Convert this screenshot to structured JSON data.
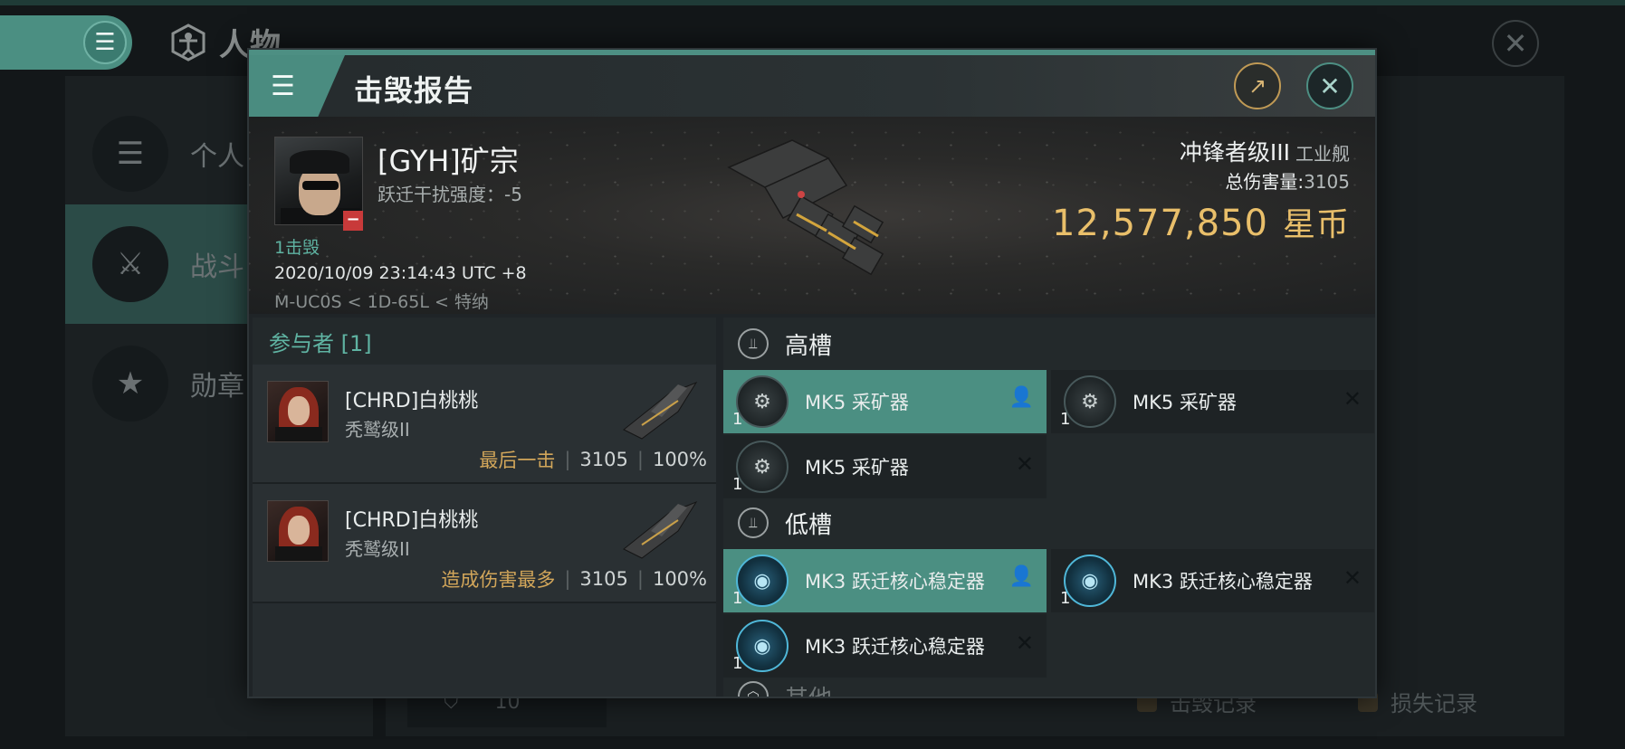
{
  "background": {
    "title": "人物",
    "side_items": [
      {
        "label": "个人",
        "icon": "list-icon"
      },
      {
        "label": "战斗",
        "icon": "crossed-swords-icon"
      },
      {
        "label": "勋章",
        "icon": "star-badge-icon"
      }
    ],
    "bottom_value": "10",
    "bottom_links": [
      "击毁记录",
      "损失记录"
    ]
  },
  "modal": {
    "title": "击毁报告",
    "victim": {
      "name": "[GYH]矿宗",
      "warp_disrupt": "跃迁干扰强度：-5",
      "kill_count": "1击毁",
      "time": "2020/10/09 23:14:43 UTC +8",
      "location": "M-UC0S < 1D-65L < 特纳"
    },
    "ship": {
      "name": "冲锋者级III",
      "class": "工业舰",
      "damage_label": "总伤害量:",
      "damage_value": "3105",
      "isk_value": "12,577,850",
      "isk_unit": "星币"
    },
    "participants": {
      "header": "参与者 [1]",
      "rows": [
        {
          "name": "[CHRD]白桃桃",
          "ship": "秃鹫级II",
          "tag": "最后一击",
          "damage": "3105",
          "percent": "100%"
        },
        {
          "name": "[CHRD]白桃桃",
          "ship": "秃鹫级II",
          "tag": "造成伤害最多",
          "damage": "3105",
          "percent": "100%"
        }
      ]
    },
    "slots": {
      "high_label": "高槽",
      "high": [
        {
          "name": "MK5 采矿器",
          "qty": "1",
          "state": "fitted"
        },
        {
          "name": "MK5 采矿器",
          "qty": "1",
          "state": "destroyed"
        },
        {
          "name": "MK5 采矿器",
          "qty": "1",
          "state": "destroyed"
        }
      ],
      "low_label": "低槽",
      "low": [
        {
          "name": "MK3 跃迁核心稳定器",
          "qty": "1",
          "state": "fitted"
        },
        {
          "name": "MK3 跃迁核心稳定器",
          "qty": "1",
          "state": "destroyed"
        },
        {
          "name": "MK3 跃迁核心稳定器",
          "qty": "1",
          "state": "destroyed"
        }
      ],
      "other_label": "其他"
    },
    "symbols": {
      "fitted": "👤",
      "destroyed": "✕"
    }
  },
  "colors": {
    "accent": "#4b8f82",
    "isk": "#e9bf6a",
    "tag": "#d2a65a"
  }
}
